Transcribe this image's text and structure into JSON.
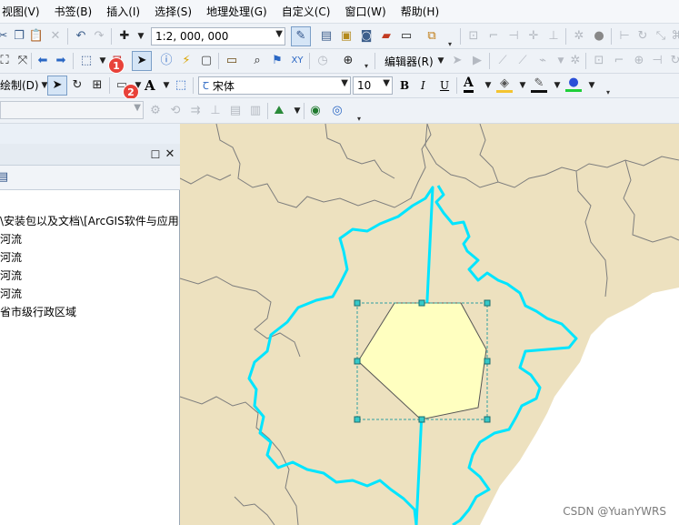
{
  "menubar": {
    "items": [
      "视图(V)",
      "书签(B)",
      "插入(I)",
      "选择(S)",
      "地理处理(G)",
      "自定义(C)",
      "窗口(W)",
      "帮助(H)"
    ]
  },
  "toolbar1": {
    "scale_value": "1:2, 000, 000"
  },
  "toolbar2": {
    "editor_label": "编辑器(R)",
    "badge1": "1"
  },
  "toolbar3": {
    "draw_label": "绘制(D)",
    "badge2": "2",
    "text_tool": "A",
    "font_name": "宋体",
    "font_size": "10",
    "bold": "B",
    "italic": "I",
    "underline": "U",
    "font_color_glyph": "A"
  },
  "toc": {
    "rows": [
      "\\安装包以及文档\\[ArcGIS软件与应用",
      "河流",
      "河流",
      "河流",
      "河流",
      "省市级行政区域"
    ]
  },
  "colors": {
    "land": "#ede1bf",
    "boundary_highlight": "#00e5ff",
    "polygon_fill": "#ffffc0",
    "selection_handle": "#36c9c9"
  },
  "watermark": "CSDN @YuanYWRS"
}
